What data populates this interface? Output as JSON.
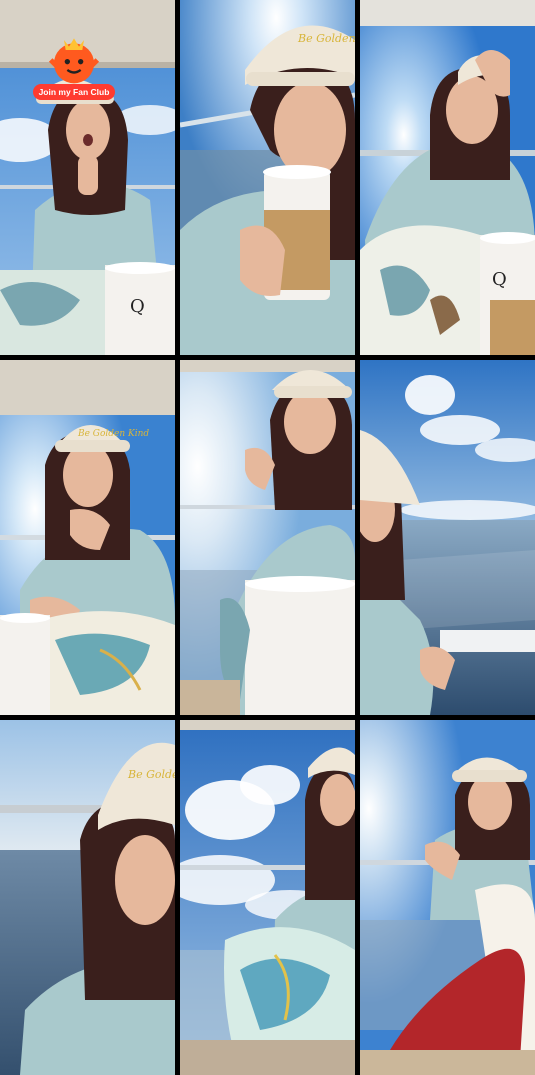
{
  "fan_club": {
    "label": "Join my Fan Club"
  },
  "hat_text": "Be Golden Kind",
  "cup_text": "Q",
  "colors": {
    "sky": "#4a8fd6",
    "hoodie": "#a9c9cc",
    "hat": "#efe7d8",
    "hat_logo": "#d8b53a",
    "hair": "#3a1f1c",
    "skin": "#e6b89c",
    "sea": "#3c5e80",
    "badge": "#ff3b30",
    "pants": "#b3262a"
  },
  "tiles": [
    {
      "scene": "balcony-yawn"
    },
    {
      "scene": "coffee-closeup"
    },
    {
      "scene": "hand-on-head"
    },
    {
      "scene": "chin-rest"
    },
    {
      "scene": "sun-sky"
    },
    {
      "scene": "ocean-view"
    },
    {
      "scene": "selfie-ocean"
    },
    {
      "scene": "blanket-clouds"
    },
    {
      "scene": "red-pants"
    }
  ]
}
